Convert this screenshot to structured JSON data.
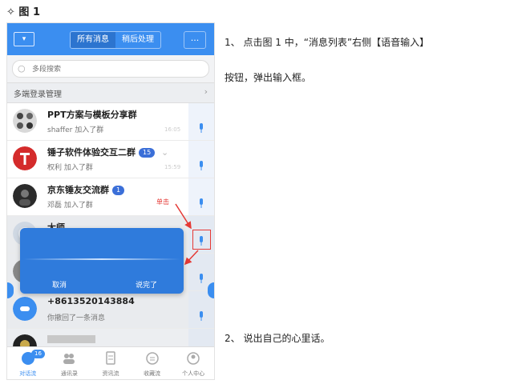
{
  "doc": {
    "title": "✧  图 1"
  },
  "app": {
    "topbar": {
      "left_icon": "back-icon",
      "tabs": [
        {
          "label": "所有消息",
          "active": true
        },
        {
          "label": "稍后处理",
          "active": false
        }
      ],
      "more_label": "···"
    },
    "search": {
      "placeholder": "多段搜索"
    },
    "multi_login": {
      "label": "多端登录管理",
      "chevron": "›"
    },
    "chats": [
      {
        "title": "PPT方案与模板分享群",
        "subtitle": "shaffer 加入了群",
        "time": "16:05"
      },
      {
        "title": "锤子软件体验交互二群",
        "badge": "15",
        "subtitle": "权利 加入了群",
        "time": "15:59"
      },
      {
        "title": "京东锤友交流群",
        "badge": "1",
        "subtitle": "邓磊 加入了群"
      },
      {
        "title": "大师"
      },
      {
        "title": "+8613520143884",
        "subtitle": "你撤回了一条消息"
      }
    ],
    "click_label": "单击",
    "voice_dialog": {
      "cancel": "取消",
      "done": "说完了"
    },
    "bottom_nav": [
      {
        "label": "对话流",
        "active": true,
        "badge": "16"
      },
      {
        "label": "通讯录"
      },
      {
        "label": "资讯流"
      },
      {
        "label": "收藏流"
      },
      {
        "label": "个人中心"
      }
    ],
    "colors": {
      "accent": "#3b8ef0",
      "dialog": "#2f7bdc",
      "alert": "#e53935"
    }
  },
  "instructions": [
    {
      "text": "1、    点击图 1 中，“消息列表”右侧【语音输入】"
    },
    {
      "text": "按钮，弹出输入框。"
    },
    {
      "text": "2、    说出自己的心里话。"
    }
  ]
}
